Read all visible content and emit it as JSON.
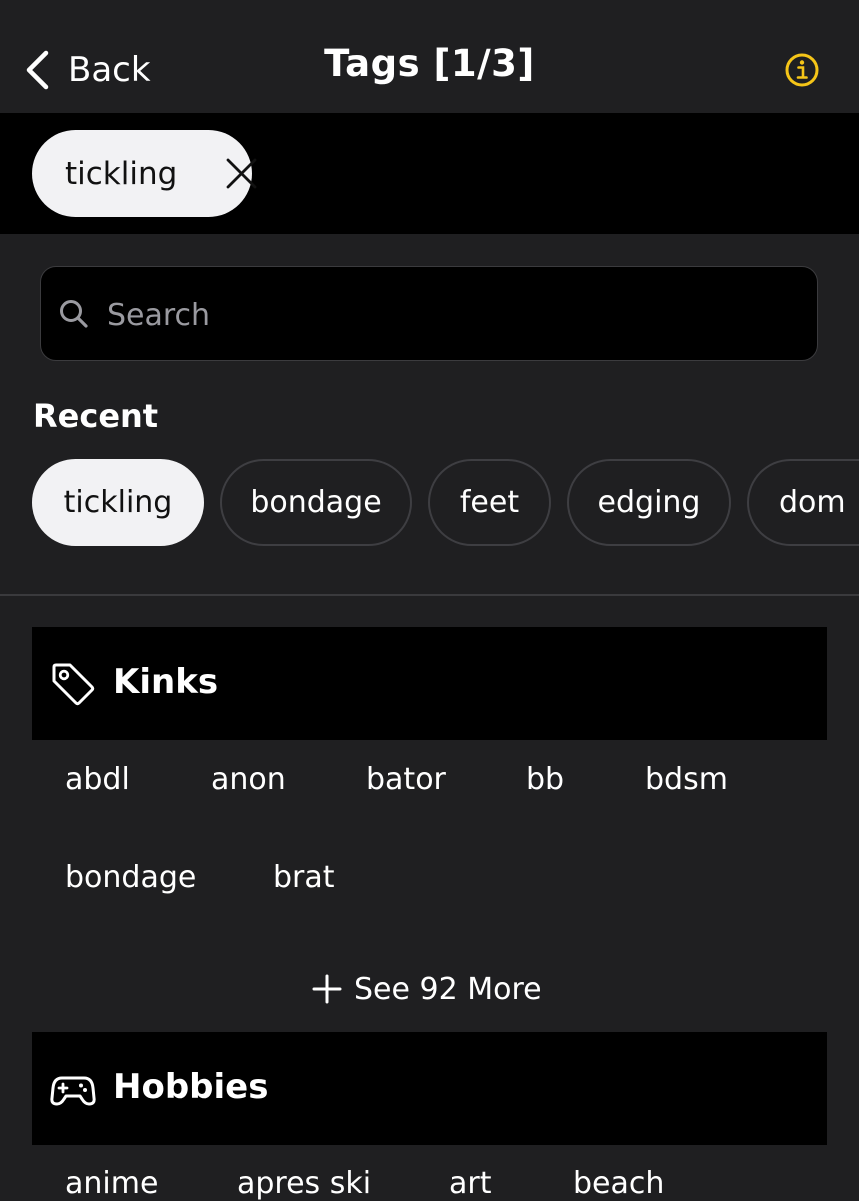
{
  "header": {
    "back_label": "Back",
    "title": "Tags [1/3]",
    "info_icon": "info-icon",
    "accent_color": "#f5c518"
  },
  "selected": {
    "tags": [
      {
        "label": "tickling"
      }
    ]
  },
  "search": {
    "placeholder": "Search",
    "value": ""
  },
  "recent": {
    "heading": "Recent",
    "tags": [
      {
        "label": "tickling",
        "active": true
      },
      {
        "label": "bondage",
        "active": false
      },
      {
        "label": "feet",
        "active": false
      },
      {
        "label": "edging",
        "active": false
      },
      {
        "label": "dom",
        "active": false
      }
    ]
  },
  "sections": [
    {
      "title": "Kinks",
      "icon": "tag-icon",
      "tags": [
        "abdl",
        "anon",
        "bator",
        "bb",
        "bdsm",
        "bondage",
        "brat"
      ],
      "see_more_label": "See 92 More"
    },
    {
      "title": "Hobbies",
      "icon": "gamepad-icon",
      "tags": [
        "anime",
        "apres ski",
        "art",
        "beach"
      ]
    }
  ]
}
